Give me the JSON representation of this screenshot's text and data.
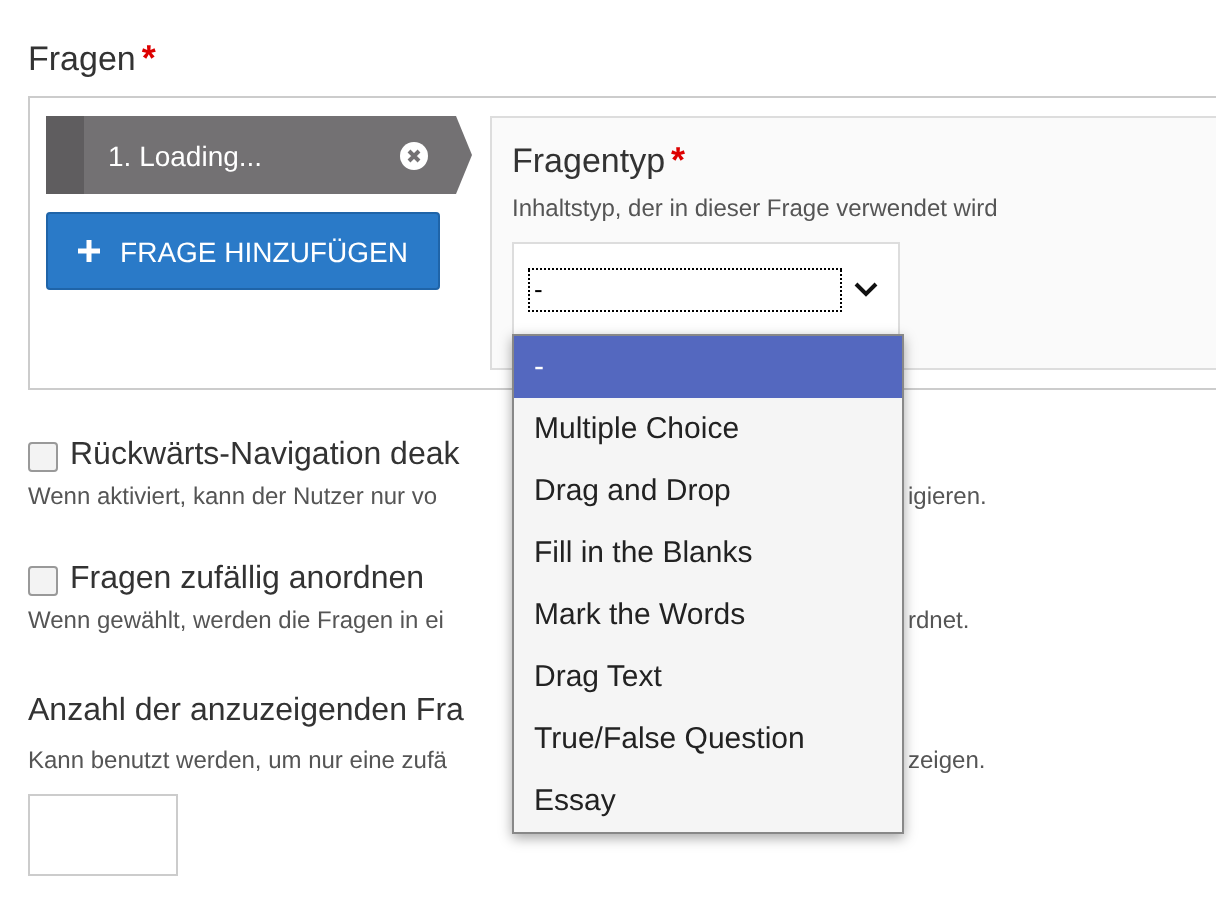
{
  "section": {
    "label": "Fragen",
    "required_mark": "*"
  },
  "questions": [
    {
      "label": "1. Loading...",
      "selected": true
    }
  ],
  "add_button": {
    "label": "FRAGE HINZUFÜGEN"
  },
  "question_type": {
    "label": "Fragentyp",
    "required_mark": "*",
    "description": "Inhaltstyp, der in dieser Frage verwendet wird",
    "value": "-",
    "expanded": true,
    "options": [
      {
        "label": "-",
        "selected": true
      },
      {
        "label": "Multiple Choice",
        "selected": false
      },
      {
        "label": "Drag and Drop",
        "selected": false
      },
      {
        "label": "Fill in the Blanks",
        "selected": false
      },
      {
        "label": "Mark the Words",
        "selected": false
      },
      {
        "label": "Drag Text",
        "selected": false
      },
      {
        "label": "True/False Question",
        "selected": false
      },
      {
        "label": "Essay",
        "selected": false
      }
    ]
  },
  "settings": [
    {
      "kind": "checkbox",
      "label": "Rückwärts-Navigation deak",
      "checked": false,
      "description_start": "Wenn aktiviert, kann der Nutzer nur vo",
      "description_end": "igieren."
    },
    {
      "kind": "checkbox",
      "label": "Fragen zufällig anordnen",
      "checked": false,
      "description_start": "Wenn gewählt, werden die Fragen in ei",
      "description_end": "rdnet."
    },
    {
      "kind": "number",
      "label": "Anzahl der anzuzeigenden Fra",
      "description_start": "Kann benutzt werden, um nur eine zufä",
      "description_end": "zeigen."
    }
  ]
}
